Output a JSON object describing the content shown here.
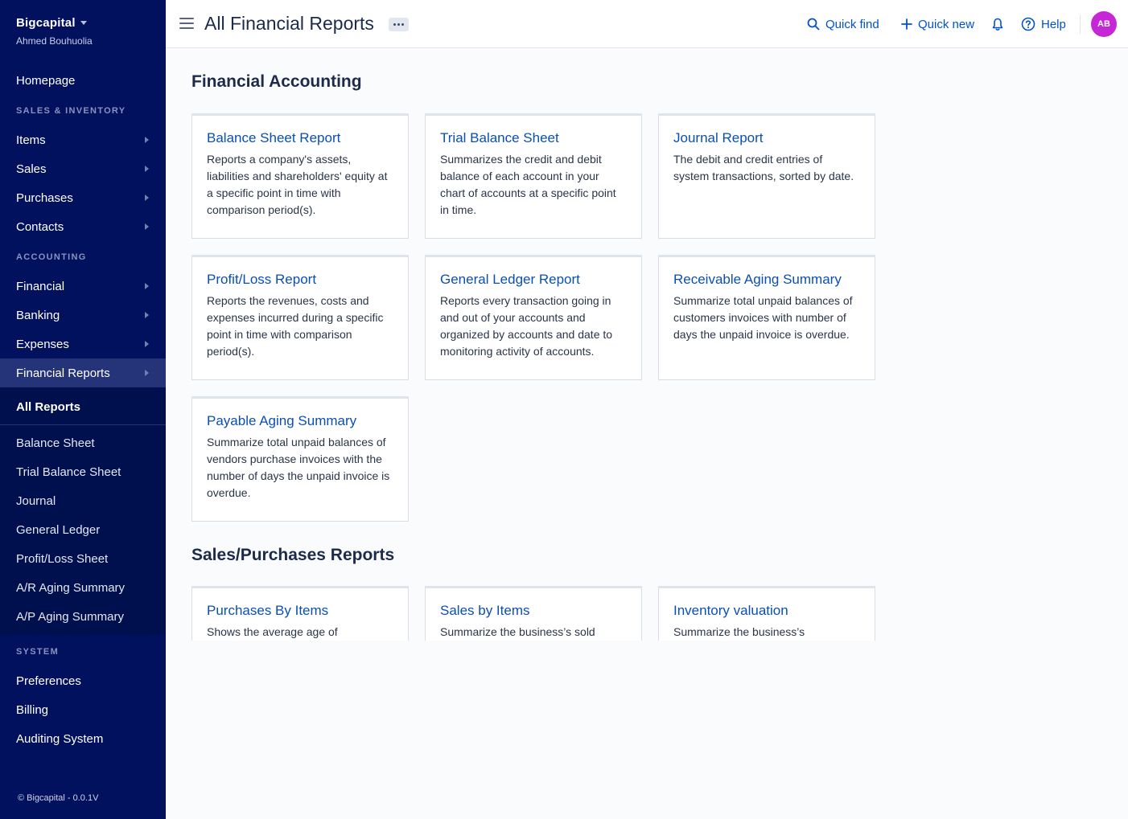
{
  "app": {
    "org_name": "Bigcapital",
    "user_name": "Ahmed Bouhuolia",
    "footer": "© Bigcapital - 0.0.1V"
  },
  "sidebar": {
    "homepage": "Homepage",
    "section_sales": "SALES & INVENTORY",
    "items": "Items",
    "sales": "Sales",
    "purchases": "Purchases",
    "contacts": "Contacts",
    "section_accounting": "ACCOUNTING",
    "financial": "Financial",
    "banking": "Banking",
    "expenses": "Expenses",
    "financial_reports": "Financial Reports",
    "submenu": {
      "all_reports": "All Reports",
      "balance_sheet": "Balance Sheet",
      "trial_balance": "Trial Balance Sheet",
      "journal": "Journal",
      "general_ledger": "General Ledger",
      "profit_loss": "Profit/Loss Sheet",
      "ar_aging": "A/R Aging Summary",
      "ap_aging": "A/P Aging Summary"
    },
    "section_system": "SYSTEM",
    "preferences": "Preferences",
    "billing": "Billing",
    "auditing": "Auditing System"
  },
  "topbar": {
    "title": "All Financial Reports",
    "quick_find": "Quick find",
    "quick_new": "Quick new",
    "help": "Help",
    "avatar_initials": "AB"
  },
  "sections": {
    "financial_accounting": "Financial Accounting",
    "sales_purchases": "Sales/Purchases Reports"
  },
  "financial_cards": {
    "balance_sheet": {
      "title": "Balance Sheet Report",
      "desc": "Reports a company's assets, liabilities and shareholders' equity at a specific point in time with comparison period(s)."
    },
    "trial_balance": {
      "title": "Trial Balance Sheet",
      "desc": "Summarizes the credit and debit balance of each account in your chart of accounts at a specific point in time."
    },
    "journal": {
      "title": "Journal Report",
      "desc": "The debit and credit entries of system transactions, sorted by date."
    },
    "profit_loss": {
      "title": "Profit/Loss Report",
      "desc": "Reports the revenues, costs and expenses incurred during a specific point in time with comparison period(s)."
    },
    "general_ledger": {
      "title": "General Ledger Report",
      "desc": "Reports every transaction going in and out of your accounts and organized by accounts and date to monitoring activity of accounts."
    },
    "receivable_aging": {
      "title": "Receivable Aging Summary",
      "desc": "Summarize total unpaid balances of customers invoices with number of days the unpaid invoice is overdue."
    },
    "payable_aging": {
      "title": "Payable Aging Summary",
      "desc": "Summarize total unpaid balances of vendors purchase invoices with the number of days the unpaid invoice is overdue."
    }
  },
  "sales_cards": {
    "purchases_by_items": {
      "title": "Purchases By Items",
      "desc": "Shows the average age of"
    },
    "sales_by_items": {
      "title": "Sales by Items",
      "desc": "Summarize the business’s sold"
    },
    "inventory_valuation": {
      "title": "Inventory valuation",
      "desc": "Summarize the business’s"
    }
  }
}
